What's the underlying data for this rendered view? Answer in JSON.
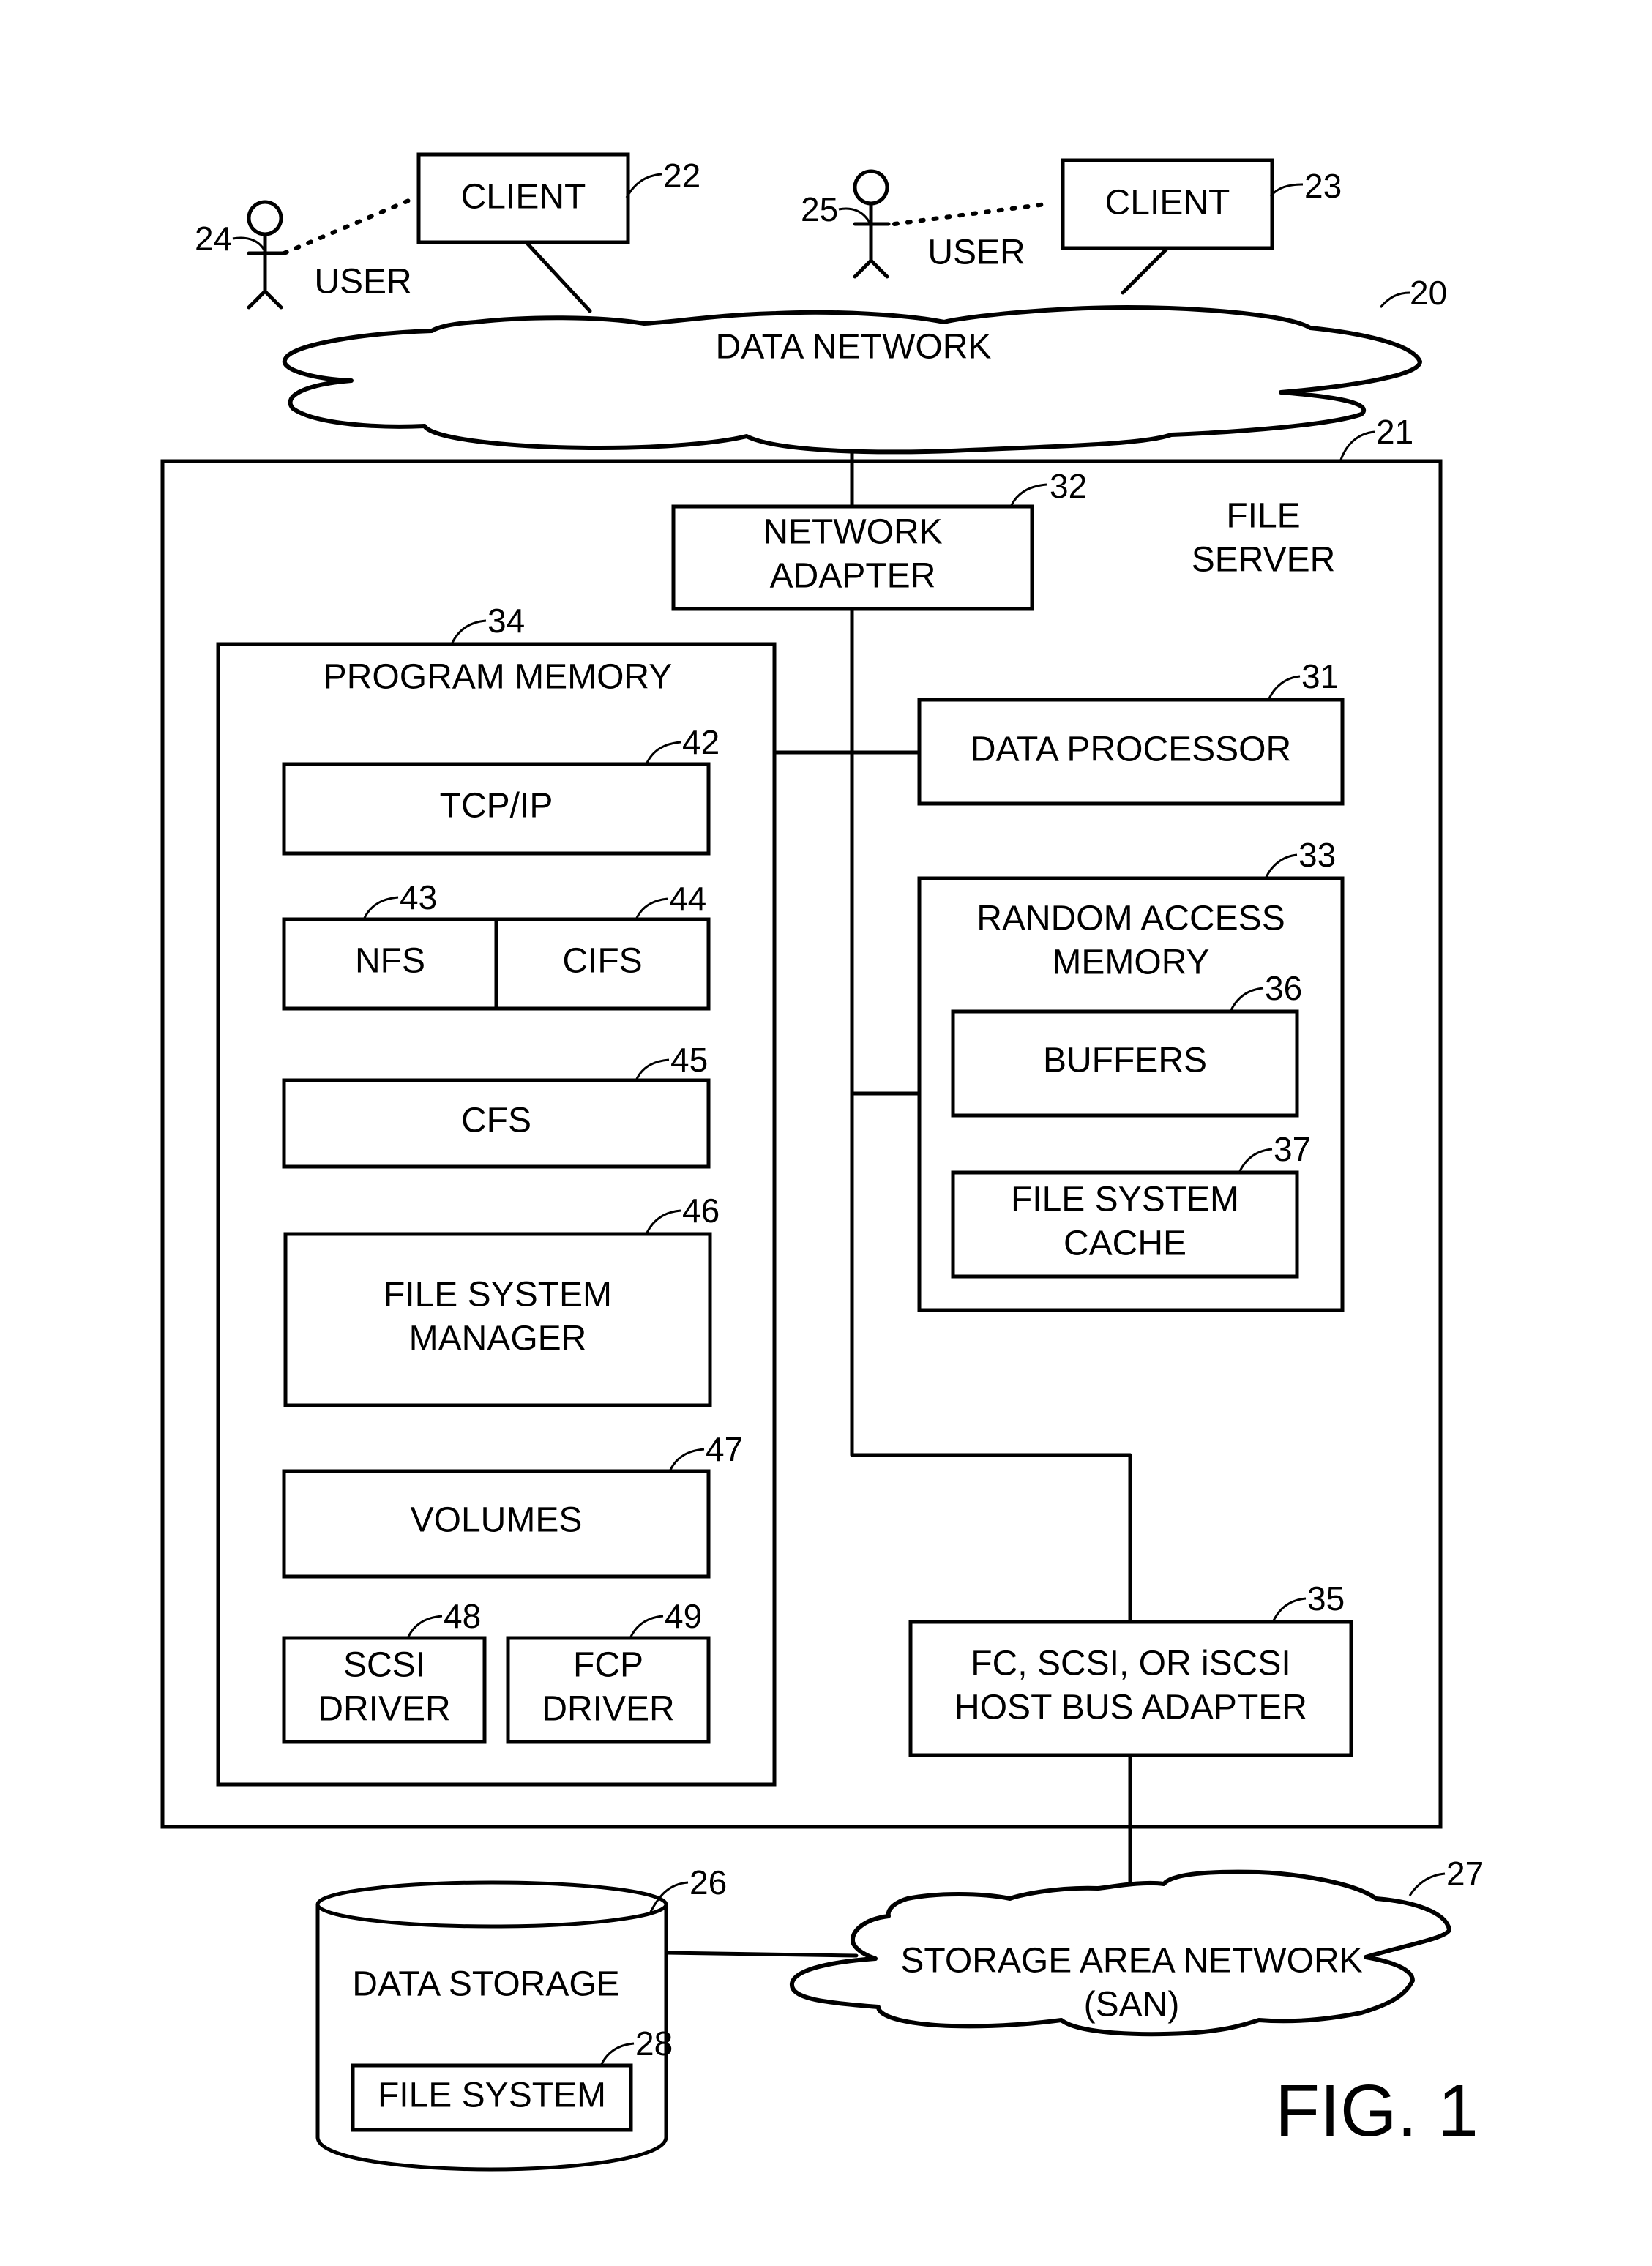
{
  "figure_label": "FIG. 1",
  "network": {
    "label": "DATA  NETWORK",
    "ref": "20"
  },
  "clients": [
    {
      "label": "CLIENT",
      "ref": "22"
    },
    {
      "label": "CLIENT",
      "ref": "23"
    }
  ],
  "users": [
    {
      "label": "USER",
      "ref": "24"
    },
    {
      "label": "USER",
      "ref": "25"
    }
  ],
  "file_server": {
    "label_lines": [
      "FILE",
      "SERVER"
    ],
    "ref": "21",
    "network_adapter": {
      "lines": [
        "NETWORK",
        "ADAPTER"
      ],
      "ref": "32"
    },
    "data_processor": {
      "label": "DATA PROCESSOR",
      "ref": "31"
    },
    "ram": {
      "lines": [
        "RANDOM ACCESS",
        "MEMORY"
      ],
      "ref": "33",
      "buffers": {
        "label": "BUFFERS",
        "ref": "36"
      },
      "fs_cache": {
        "lines": [
          "FILE SYSTEM",
          "CACHE"
        ],
        "ref": "37"
      }
    },
    "hba": {
      "lines": [
        "FC, SCSI, OR iSCSI",
        "HOST BUS ADAPTER"
      ],
      "ref": "35"
    },
    "program_memory": {
      "label": "PROGRAM MEMORY",
      "ref": "34",
      "tcpip": {
        "label": "TCP/IP",
        "ref": "42"
      },
      "nfs": {
        "label": "NFS",
        "ref": "43"
      },
      "cifs": {
        "label": "CIFS",
        "ref": "44"
      },
      "cfs": {
        "label": "CFS",
        "ref": "45"
      },
      "fsm": {
        "lines": [
          "FILE SYSTEM",
          "MANAGER"
        ],
        "ref": "46"
      },
      "volumes": {
        "label": "VOLUMES",
        "ref": "47"
      },
      "scsi_driver": {
        "lines": [
          "SCSI",
          "DRIVER"
        ],
        "ref": "48"
      },
      "fcp_driver": {
        "lines": [
          "FCP",
          "DRIVER"
        ],
        "ref": "49"
      }
    }
  },
  "data_storage": {
    "label": "DATA STORAGE",
    "ref": "26",
    "file_system": {
      "label": "FILE SYSTEM",
      "ref": "28"
    }
  },
  "san": {
    "lines": [
      "STORAGE AREA NETWORK",
      "(SAN)"
    ],
    "ref": "27"
  }
}
